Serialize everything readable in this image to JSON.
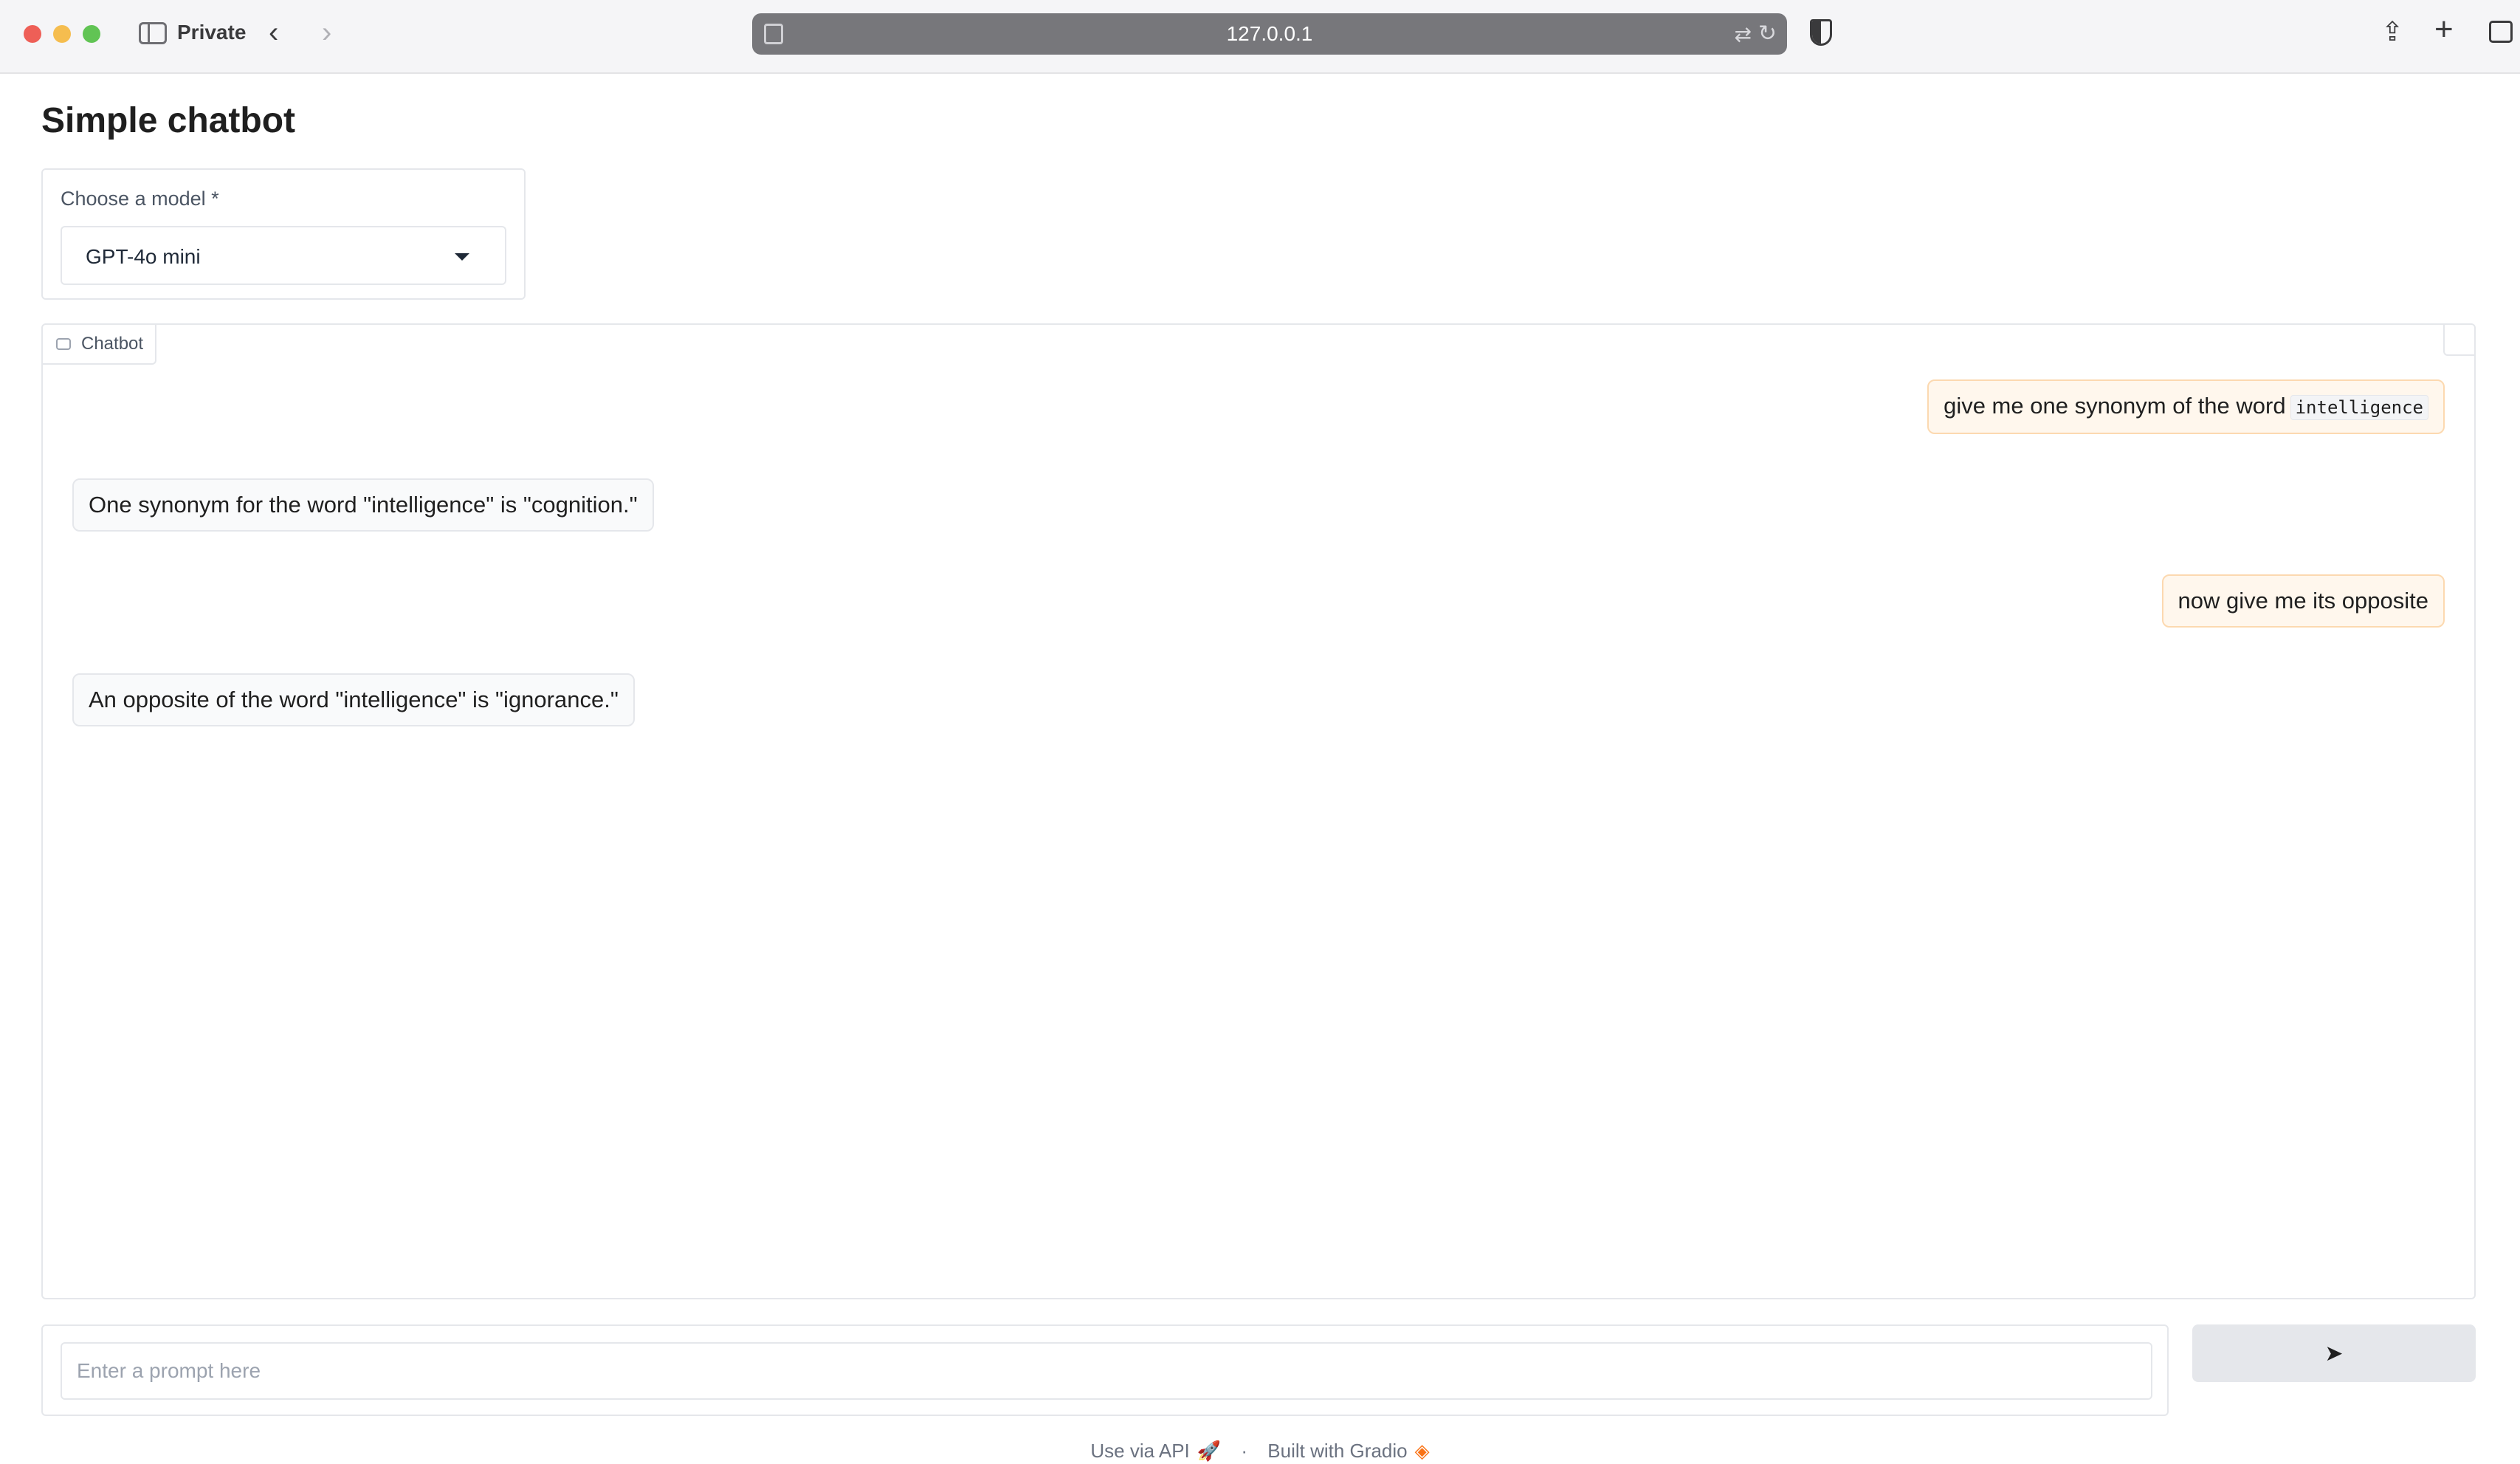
{
  "browser": {
    "mode_label": "Private",
    "url": "127.0.0.1",
    "icons": {
      "sidebar": "sidebar-icon",
      "back": "chevron-left-icon",
      "forward": "chevron-right-icon",
      "page": "page-icon",
      "translate": "translate-icon",
      "reload": "reload-icon",
      "shield": "shield-icon",
      "share": "share-icon",
      "new_tab": "plus-icon",
      "tabs": "tabs-overview-icon"
    }
  },
  "app": {
    "title": "Simple chatbot"
  },
  "model_picker": {
    "label": "Choose a model *",
    "selected": "GPT-4o mini"
  },
  "chatbot": {
    "tag_label": "Chatbot",
    "messages": [
      {
        "role": "user",
        "text": "give me one synonym of the word",
        "code": "intelligence"
      },
      {
        "role": "bot",
        "text": "One synonym for the word \"intelligence\" is \"cognition.\""
      },
      {
        "role": "user",
        "text": "now give me its opposite"
      },
      {
        "role": "bot",
        "text": "An opposite of the word \"intelligence\" is \"ignorance.\""
      }
    ]
  },
  "prompt": {
    "placeholder": "Enter a prompt here",
    "value": "",
    "send_label": "➤"
  },
  "footer": {
    "api_label": "Use via API",
    "separator": "·",
    "built_label": "Built with Gradio"
  },
  "colors": {
    "user_bubble": "#fff7ed",
    "bot_bubble": "#f9fafb",
    "accent": "#f97316"
  }
}
